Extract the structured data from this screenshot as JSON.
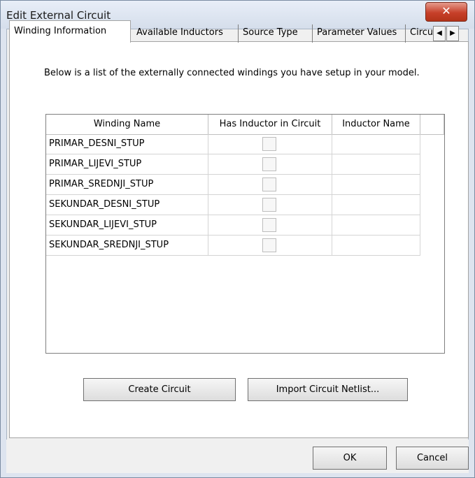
{
  "window": {
    "title": "Edit External Circuit"
  },
  "tabs": [
    {
      "label": "Winding Information",
      "active": true
    },
    {
      "label": "Available Inductors",
      "active": false
    },
    {
      "label": "Source Type",
      "active": false
    },
    {
      "label": "Parameter Values",
      "active": false
    },
    {
      "label": "Circu",
      "active": false
    }
  ],
  "description": "Below is a list of the externally connected windings you have setup in your model.",
  "grid": {
    "columns": [
      "Winding Name",
      "Has Inductor in Circuit",
      "Inductor Name"
    ],
    "rows": [
      {
        "winding": "PRIMAR_DESNI_STUP",
        "has_inductor": false,
        "inductor": ""
      },
      {
        "winding": "PRIMAR_LIJEVI_STUP",
        "has_inductor": false,
        "inductor": ""
      },
      {
        "winding": "PRIMAR_SREDNJI_STUP",
        "has_inductor": false,
        "inductor": ""
      },
      {
        "winding": "SEKUNDAR_DESNI_STUP",
        "has_inductor": false,
        "inductor": ""
      },
      {
        "winding": "SEKUNDAR_LIJEVI_STUP",
        "has_inductor": false,
        "inductor": ""
      },
      {
        "winding": "SEKUNDAR_SREDNJI_STUP",
        "has_inductor": false,
        "inductor": ""
      }
    ]
  },
  "buttons": {
    "create_circuit": "Create Circuit",
    "import_netlist": "Import Circuit Netlist...",
    "ok": "OK",
    "cancel": "Cancel"
  },
  "icons": {
    "close": "close-icon",
    "tab_left": "chevron-left-icon",
    "tab_right": "chevron-right-icon"
  }
}
